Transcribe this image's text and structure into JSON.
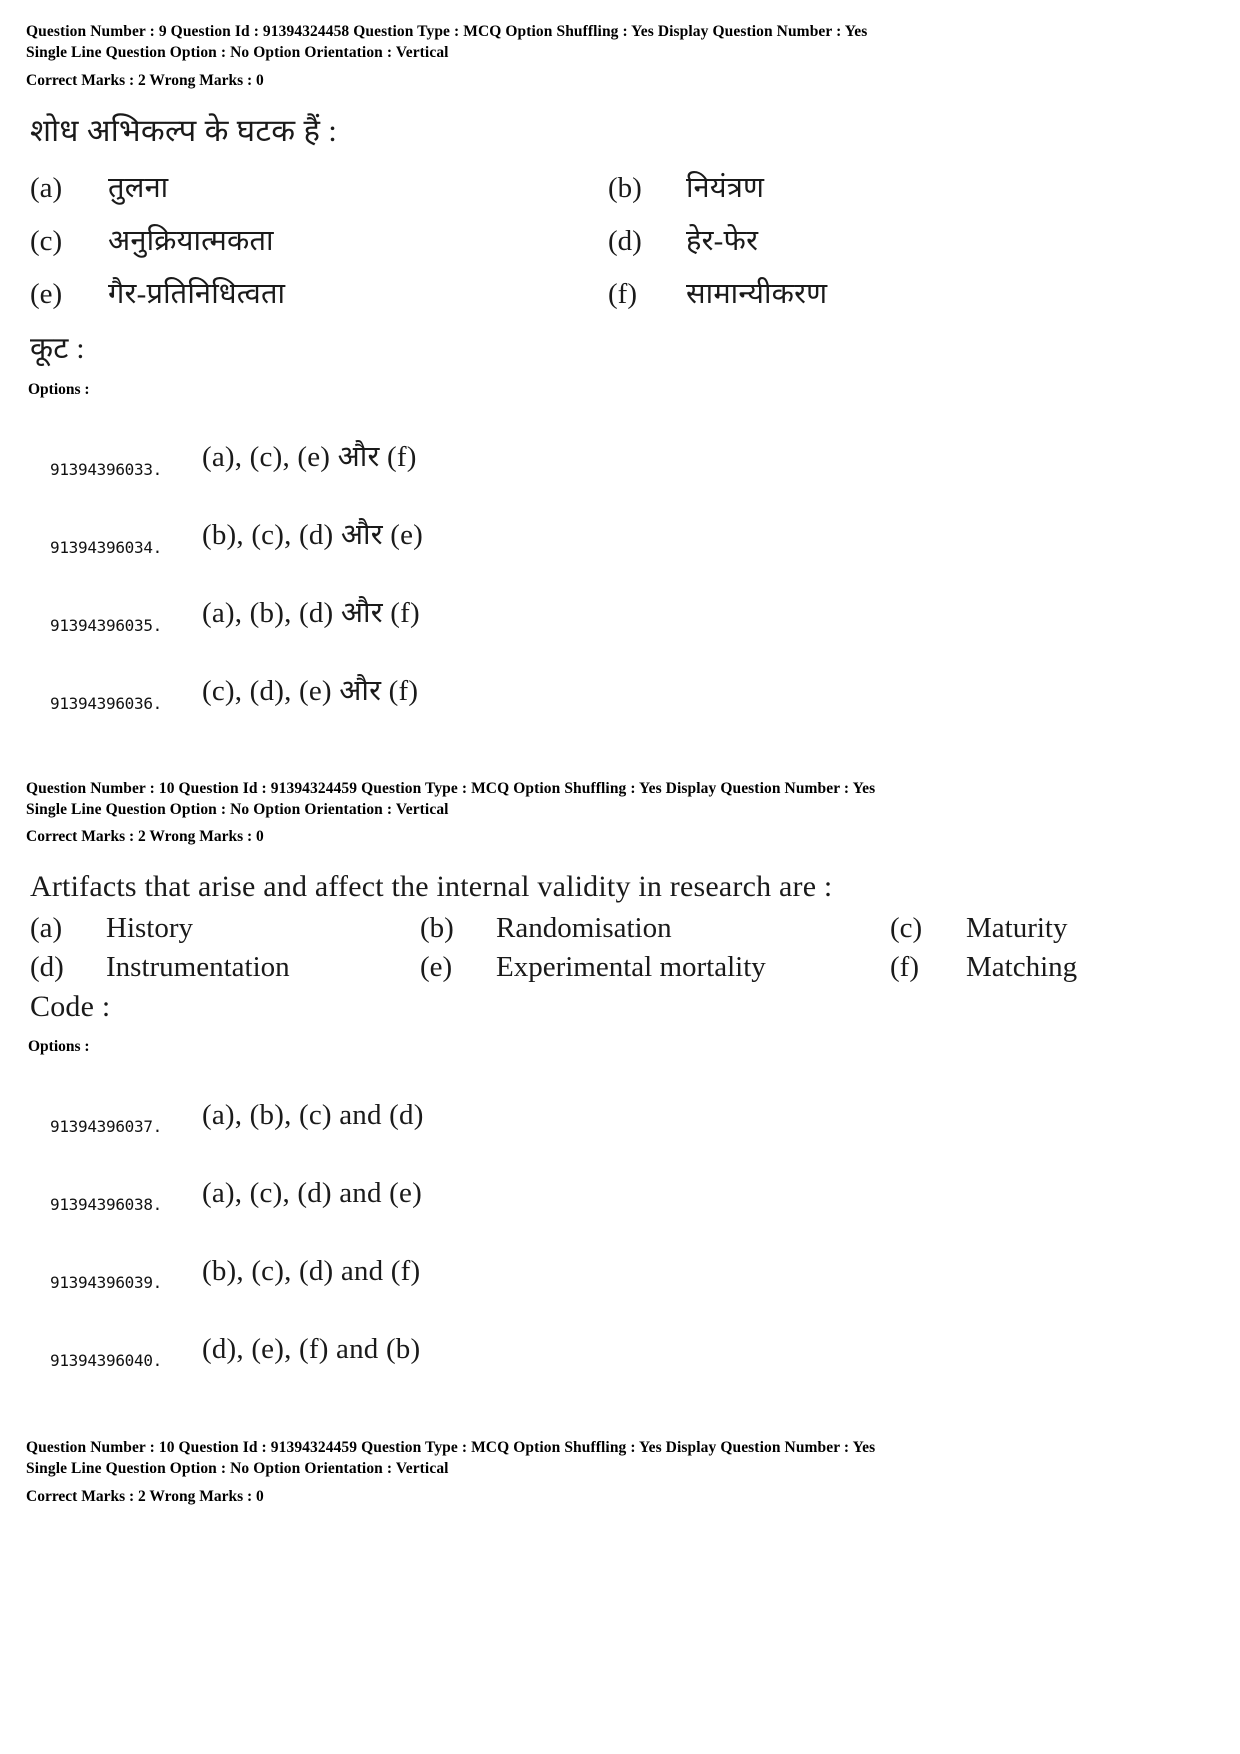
{
  "questions": [
    {
      "meta": {
        "line1": "Question Number : 9  Question Id : 91394324458  Question Type : MCQ  Option Shuffling : Yes  Display Question Number : Yes",
        "line2": "Single Line Question Option : No  Option Orientation : Vertical",
        "marks": "Correct Marks : 2  Wrong Marks : 0"
      },
      "stem": "शोध अभिकल्प के घटक हैं :",
      "subitems": [
        {
          "label": "(a)",
          "text": "तुलना"
        },
        {
          "label": "(b)",
          "text": "नियंत्रण"
        },
        {
          "label": "(c)",
          "text": "अनुक्रियात्मकता"
        },
        {
          "label": "(d)",
          "text": "हेर-फेर"
        },
        {
          "label": "(e)",
          "text": "गैर-प्रतिनिधित्वता"
        },
        {
          "label": "(f)",
          "text": "सामान्यीकरण"
        }
      ],
      "code_label": "कूट :",
      "options_heading": "Options :",
      "options": [
        {
          "id": "91394396033.",
          "text": "(a), (c), (e) और (f)"
        },
        {
          "id": "91394396034.",
          "text": "(b), (c), (d) और (e)"
        },
        {
          "id": "91394396035.",
          "text": "(a), (b), (d) और (f)"
        },
        {
          "id": "91394396036.",
          "text": "(c), (d), (e) और (f)"
        }
      ]
    },
    {
      "meta": {
        "line1": "Question Number : 10  Question Id : 91394324459  Question Type : MCQ  Option Shuffling : Yes  Display Question Number : Yes",
        "line2": "Single Line Question Option : No  Option Orientation : Vertical",
        "marks": "Correct Marks : 2  Wrong Marks : 0"
      },
      "stem": "Artifacts that arise and affect the internal validity in research are :",
      "subitems": [
        {
          "label": "(a)",
          "text": "History"
        },
        {
          "label": "(b)",
          "text": "Randomisation"
        },
        {
          "label": "(c)",
          "text": "Maturity"
        },
        {
          "label": "(d)",
          "text": "Instrumentation"
        },
        {
          "label": "(e)",
          "text": "Experimental mortality"
        },
        {
          "label": "(f)",
          "text": "Matching"
        }
      ],
      "code_label": "Code :",
      "options_heading": "Options :",
      "options": [
        {
          "id": "91394396037.",
          "text": "(a), (b), (c) and (d)"
        },
        {
          "id": "91394396038.",
          "text": "(a), (c), (d) and (e)"
        },
        {
          "id": "91394396039.",
          "text": "(b), (c), (d) and (f)"
        },
        {
          "id": "91394396040.",
          "text": "(d), (e), (f) and (b)"
        }
      ]
    }
  ],
  "footer": {
    "line1": "Question Number : 10  Question Id : 91394324459  Question Type : MCQ  Option Shuffling : Yes  Display Question Number : Yes",
    "line2": "Single Line Question Option : No  Option Orientation : Vertical",
    "marks": "Correct Marks : 2  Wrong Marks : 0"
  }
}
